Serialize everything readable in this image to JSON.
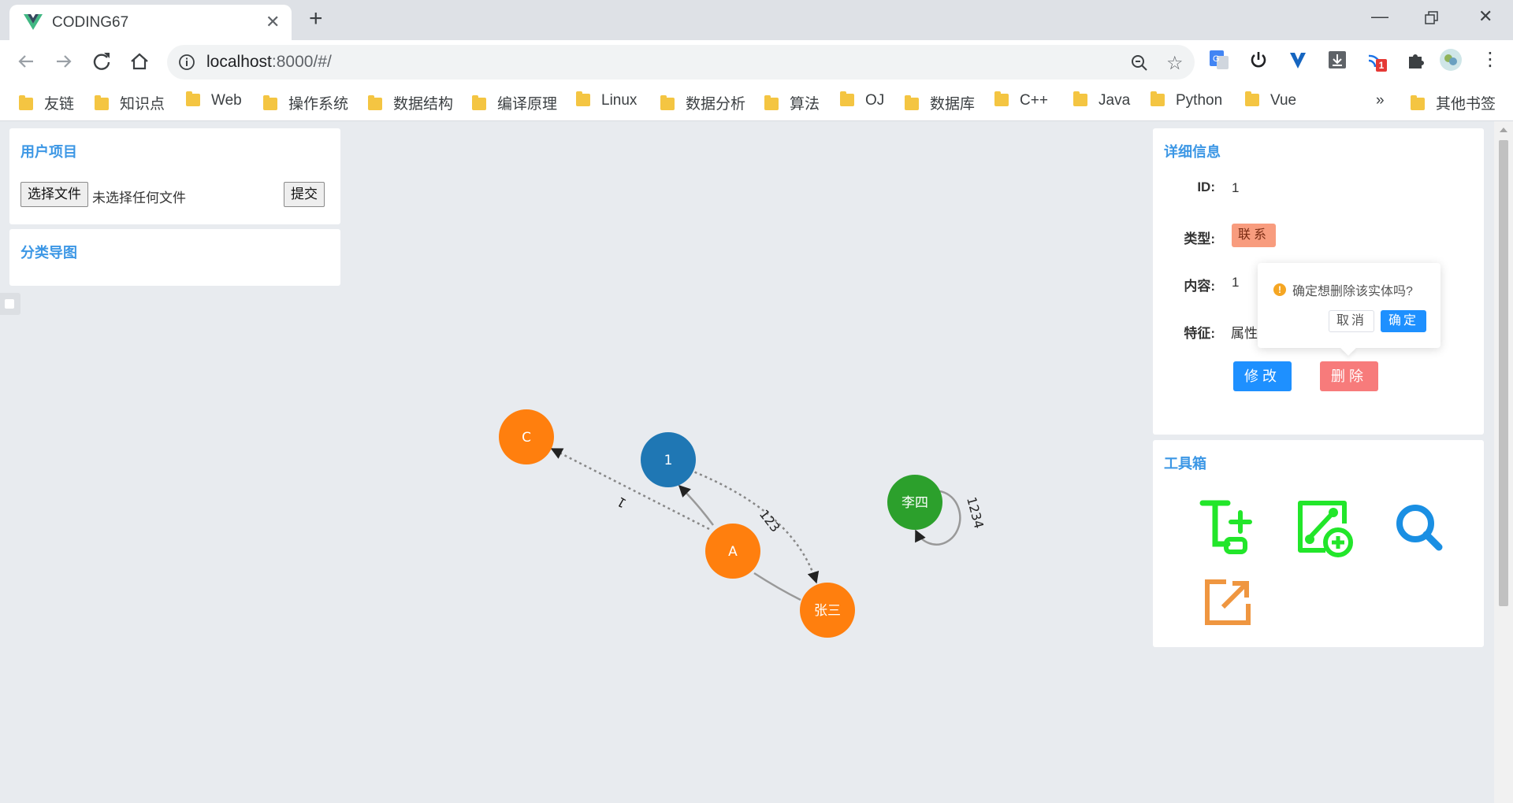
{
  "browser": {
    "tab_title": "CODING67",
    "url_host": "localhost",
    "url_path": ":8000/#/",
    "extension_badge": "1",
    "bookmarks": [
      "友链",
      "知识点",
      "Web",
      "操作系统",
      "数据结构",
      "编译原理",
      "Linux",
      "数据分析",
      "算法",
      "OJ",
      "数据库",
      "C++",
      "Java",
      "Python",
      "Vue"
    ],
    "more_bookmarks": "»",
    "other_bookmarks": "其他书签"
  },
  "left": {
    "user_project_title": "用户项目",
    "choose_file_label": "选择文件",
    "no_file_text": "未选择任何文件",
    "submit_label": "提交",
    "category_map_title": "分类导图"
  },
  "detail": {
    "title": "详细信息",
    "id_label": "ID:",
    "id_value": "1",
    "type_label": "类型:",
    "type_value": "联系",
    "content_label": "内容:",
    "content_value": "1",
    "feature_label": "特征:",
    "feature_value": "属性",
    "edit_label": "修改",
    "delete_label": "删除"
  },
  "popconfirm": {
    "message": "确定想删除该实体吗?",
    "cancel_label": "取消",
    "confirm_label": "确定"
  },
  "toolbox": {
    "title": "工具箱",
    "tools": [
      "add-node-icon",
      "add-link-icon",
      "search-icon",
      "export-icon"
    ]
  },
  "graph": {
    "nodes": [
      {
        "label": "C",
        "color": "#ff7f0e"
      },
      {
        "label": "1",
        "color": "#1f77b4"
      },
      {
        "label": "A",
        "color": "#ff7f0e"
      },
      {
        "label": "张三",
        "color": "#ff7f0e"
      },
      {
        "label": "李四",
        "color": "#2ca02c"
      }
    ],
    "edge_labels": [
      "1",
      "123",
      "1234"
    ]
  },
  "colors": {
    "accent": "#3c97e5",
    "primary_button": "#1e90ff",
    "danger_button": "#f77b7b",
    "tag": "#f89c7e",
    "tool_green": "#22e62a",
    "tool_blue": "#1a8fe3",
    "tool_orange": "#ef9640"
  }
}
